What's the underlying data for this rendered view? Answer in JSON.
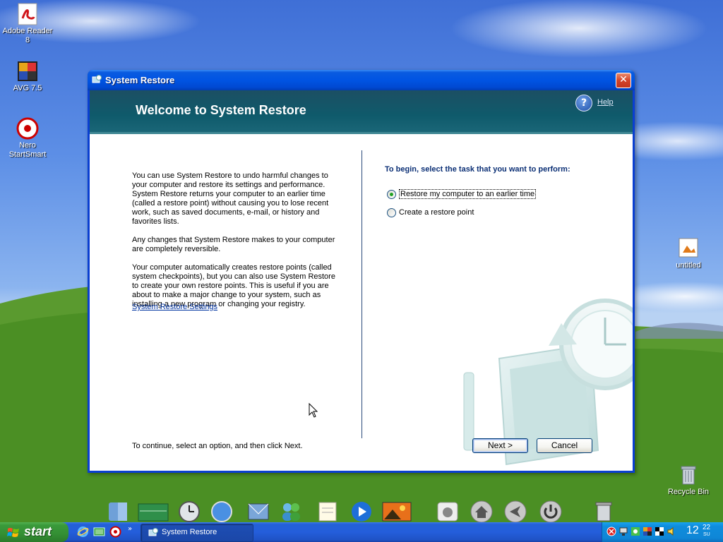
{
  "desktop": {
    "icons": [
      {
        "label": "Adobe Reader 8",
        "icon": "adobe-reader-icon"
      },
      {
        "label": "AVG 7.5",
        "icon": "avg-icon"
      },
      {
        "label": "Nero StartSmart",
        "icon": "nero-icon"
      },
      {
        "label": "untitled",
        "icon": "image-file-icon"
      },
      {
        "label": "Recycle Bin",
        "icon": "recycle-bin-icon"
      }
    ]
  },
  "window": {
    "title": "System Restore",
    "header_title": "Welcome to System Restore",
    "help_label": "Help",
    "intro_paragraphs": [
      "You can use System Restore to undo harmful changes to your computer and restore its settings and performance. System Restore returns your computer to an earlier time (called a restore point) without causing you to lose recent work, such as saved documents, e-mail, or history and favorites lists.",
      "Any changes that System Restore makes to your computer are completely reversible.",
      "Your computer automatically creates restore points (called system checkpoints), but you can also use System Restore to create your own restore points. This is useful if you are about to make a major change to your system, such as installing a new program or changing your registry."
    ],
    "settings_link": "System Restore Settings",
    "task_prompt": "To begin, select the task that you want to perform:",
    "options": [
      {
        "label": "Restore my computer to an earlier time",
        "selected": true
      },
      {
        "label": "Create a restore point",
        "selected": false
      }
    ],
    "bottom_instruction": "To continue, select an option, and then click Next.",
    "next_label": "Next >",
    "cancel_label": "Cancel"
  },
  "dock": {
    "items": [
      "finder-icon",
      "network-icon",
      "clock-icon",
      "safari-icon",
      "mail-icon",
      "users-icon",
      "notes-icon",
      "media-player-icon",
      "photos-icon",
      "apple-icon",
      "home-icon",
      "back-icon",
      "power-icon",
      "trash-icon"
    ]
  },
  "taskbar": {
    "start_label": "start",
    "task_button": "System Restore",
    "clock_hour": "12",
    "clock_minute": "22",
    "clock_day": "SU"
  },
  "colors": {
    "header_band": "#0f5a6b",
    "title_bar": "#0054e3",
    "link": "#0033a0",
    "prompt": "#0b2f75",
    "taskbar": "#245edb",
    "start": "#3a9a3a"
  }
}
